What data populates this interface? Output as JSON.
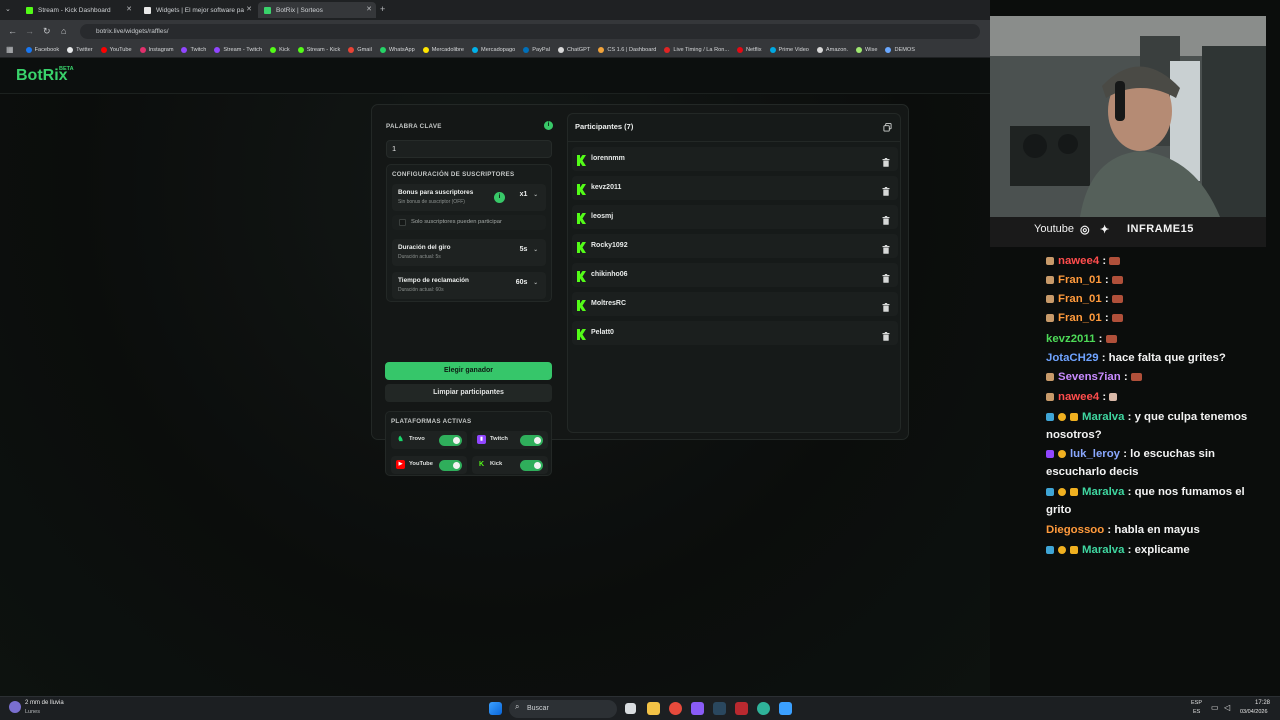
{
  "browser": {
    "tabs": [
      {
        "label": "Stream - Kick Dashboard",
        "color": "#53fc18"
      },
      {
        "label": "Widgets | El mejor software pa",
        "color": "#f0f0f0"
      },
      {
        "label": "BotRix | Sorteos",
        "color": "#39d36b"
      }
    ],
    "url": "botrix.live/widgets/raffles/",
    "bookmarks": [
      {
        "label": "Facebook",
        "color": "#1877f2"
      },
      {
        "label": "Twitter",
        "color": "#e7e9ea"
      },
      {
        "label": "YouTube",
        "color": "#ff0000"
      },
      {
        "label": "Instagram",
        "color": "#e1306c"
      },
      {
        "label": "Twitch",
        "color": "#9146ff"
      },
      {
        "label": "Stream - Twitch",
        "color": "#9146ff"
      },
      {
        "label": "Kick",
        "color": "#53fc18"
      },
      {
        "label": "Stream - Kick",
        "color": "#53fc18"
      },
      {
        "label": "Gmail",
        "color": "#ea4335"
      },
      {
        "label": "WhatsApp",
        "color": "#25d366"
      },
      {
        "label": "Mercadolibre",
        "color": "#ffe600"
      },
      {
        "label": "Mercadopago",
        "color": "#00b1ea"
      },
      {
        "label": "PayPal",
        "color": "#0070ba"
      },
      {
        "label": "ChatGPT",
        "color": "#d8d8d8"
      },
      {
        "label": "CS 1.6 | Dashboard",
        "color": "#f2a33a"
      },
      {
        "label": "Live Timing / La Ron...",
        "color": "#e02424"
      },
      {
        "label": "Netflix",
        "color": "#e50914"
      },
      {
        "label": "Prime Video",
        "color": "#00a8e1"
      },
      {
        "label": "Amazon.",
        "color": "#d8d8d8"
      },
      {
        "label": "Wise",
        "color": "#9fe870"
      },
      {
        "label": "DEMOS",
        "color": "#6aa8ff"
      }
    ]
  },
  "site": {
    "logo": "BotRix",
    "beta": "BETA"
  },
  "raffle": {
    "keyword_label": "PALABRA CLAVE",
    "keyword_value": "1",
    "sub_config_label": "CONFIGURACIÓN DE SUSCRIPTORES",
    "bonus_title": "Bonus para suscriptores",
    "bonus_sub": "Sin bonus de suscriptor (OFF)",
    "bonus_value": "x1",
    "only_subs": "Solo suscriptores pueden participar",
    "spin_title": "Duración del giro",
    "spin_sub": "Duración actual: 5s",
    "spin_value": "5s",
    "claim_title": "Tiempo de reclamación",
    "claim_sub": "Duración actual: 60s",
    "claim_value": "60s",
    "pick_winner": "Elegir ganador",
    "clear_participants": "Limpiar participantes",
    "platforms_label": "PLATAFORMAS ACTIVAS",
    "platforms": [
      {
        "name": "Trovo",
        "color": "#19d66b",
        "on": true
      },
      {
        "name": "Twitch",
        "color": "#9146ff",
        "on": true
      },
      {
        "name": "YouTube",
        "color": "#ff0000",
        "on": true
      },
      {
        "name": "Kick",
        "color": "#53fc18",
        "on": true
      }
    ],
    "participants_title": "Participantes (7)",
    "participants": [
      "lorennmm",
      "kevz2011",
      "leosmj",
      "Rocky1092",
      "chikinho06",
      "MoltresRC",
      "Pelatt0"
    ]
  },
  "overlay": {
    "social_youtube": "Youtube",
    "channel": "INFRAME15",
    "chat": [
      {
        "user": "nawee4",
        "sep": " : ",
        "text": "",
        "color": "#ff4d4d"
      },
      {
        "user": "Fran_01",
        "sep": " : ",
        "text": "",
        "color": "#ff9a3c"
      },
      {
        "user": "Fran_01",
        "sep": " : ",
        "text": "",
        "color": "#ff9a3c"
      },
      {
        "user": "Fran_01",
        "sep": " : ",
        "text": "",
        "color": "#ff9a3c"
      },
      {
        "user": "kevz2011",
        "sep": " : ",
        "text": "",
        "color": "#4dd957"
      },
      {
        "user": "JotaCH29",
        "sep": " : ",
        "text": "hace falta que grites?",
        "color": "#6fa3ff"
      },
      {
        "user": "Sevens7ian",
        "sep": " : ",
        "text": "",
        "color": "#c98cff"
      },
      {
        "user": "nawee4",
        "sep": " : ",
        "text": "",
        "color": "#ff4d4d"
      },
      {
        "user": "Maralva",
        "sep": " : ",
        "text": "y que culpa tenemos nosotros?",
        "color": "#3fd6a0"
      },
      {
        "user": "luk_leroy",
        "sep": " : ",
        "text": "lo escuchas sin escucharlo decis",
        "color": "#8aa8ff"
      },
      {
        "user": "Maralva",
        "sep": " : ",
        "text": "que nos fumamos el grito",
        "color": "#3fd6a0"
      },
      {
        "user": "Diegossoo",
        "sep": " : ",
        "text": "habla en mayus",
        "color": "#ff9a3c"
      },
      {
        "user": "Maralva",
        "sep": " : ",
        "text": "explicame",
        "color": "#3fd6a0"
      }
    ]
  },
  "taskbar": {
    "weather": "2 mm de lluvia",
    "weather_day": "Lunes",
    "search": "Buscar",
    "lang_top": "ESP",
    "lang_bottom": "ES",
    "time": "17:28",
    "date": "03/04/2026"
  }
}
